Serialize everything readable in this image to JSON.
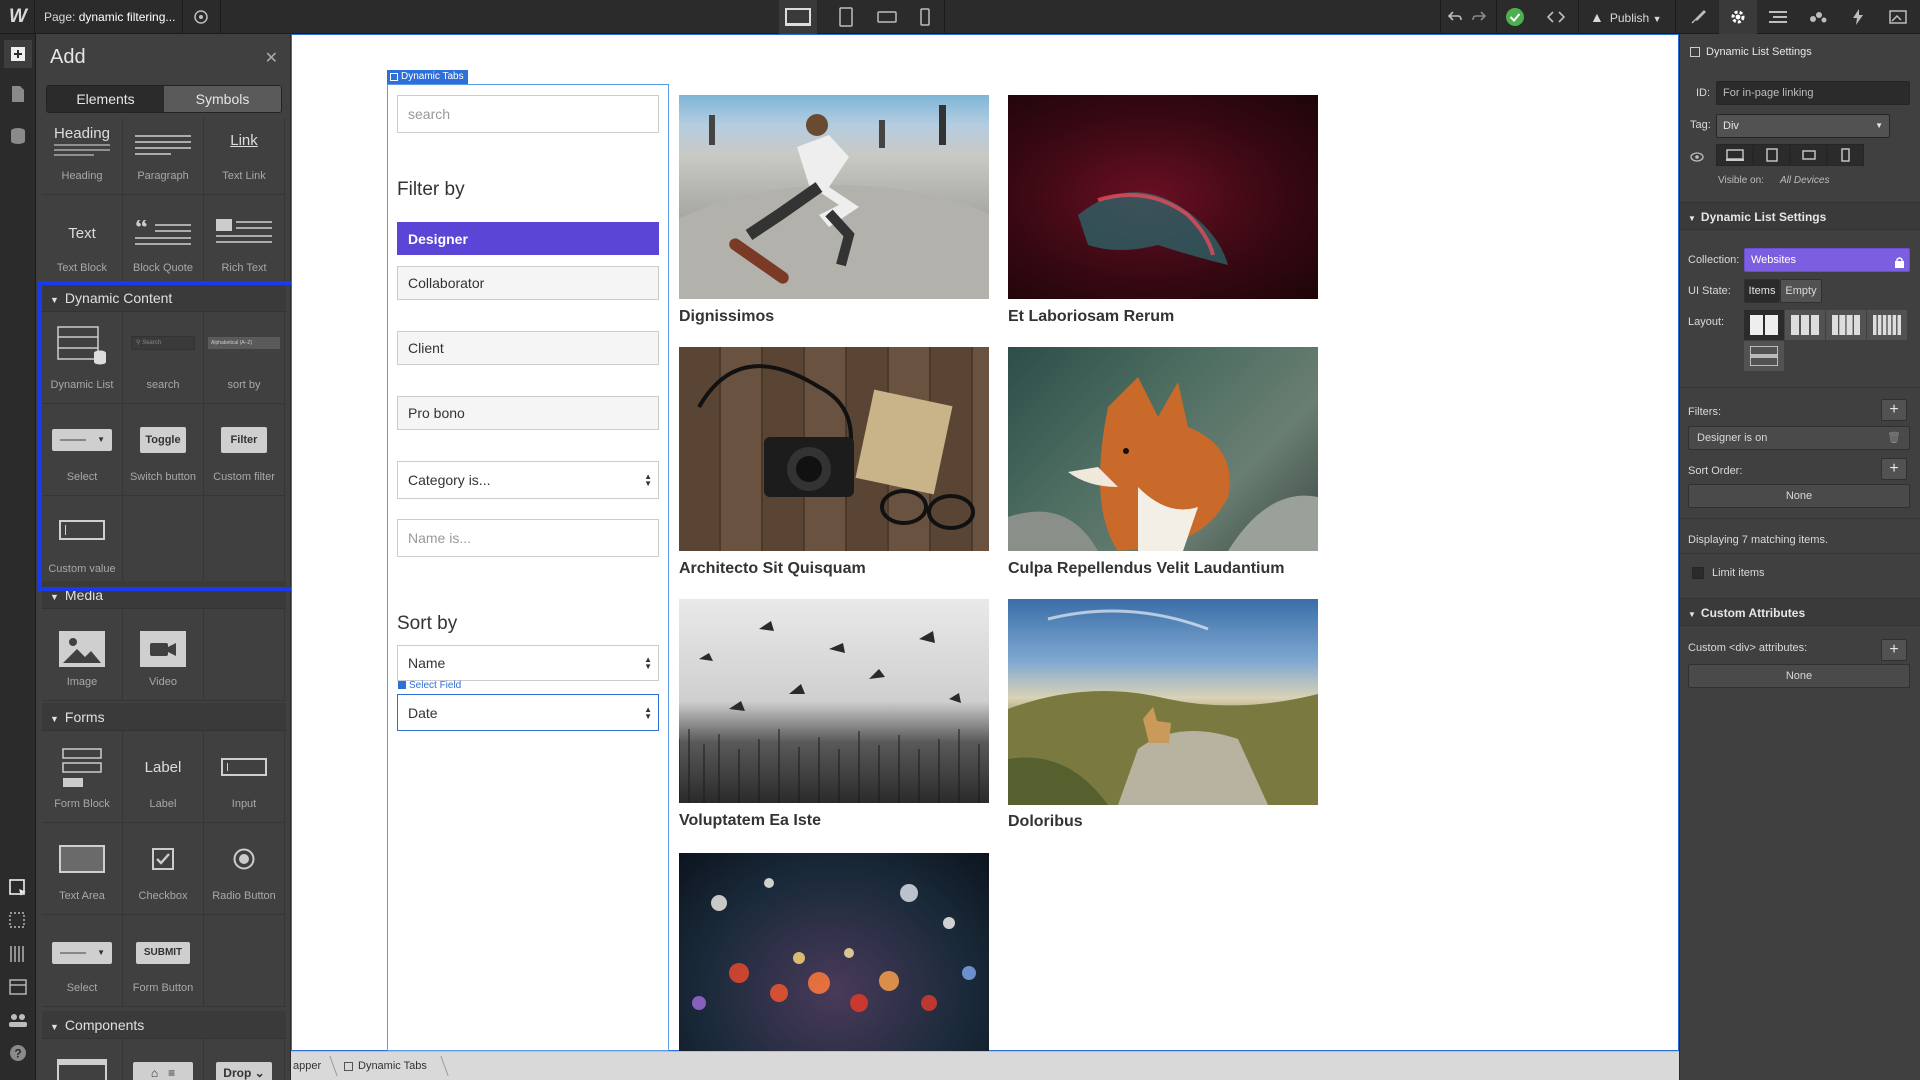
{
  "topbar": {
    "logo": "W",
    "page_prefix": "Page:",
    "page_name": "dynamic filtering...",
    "publish_label": "Publish",
    "undo_icon": "undo-icon",
    "redo_icon": "redo-icon",
    "devices": [
      "desktop",
      "tablet",
      "mobile-landscape",
      "mobile-portrait"
    ]
  },
  "add_panel": {
    "title": "Add",
    "tabs": [
      "Elements",
      "Symbols"
    ],
    "typography": [
      {
        "label": "Heading",
        "pic": "Heading"
      },
      {
        "label": "Paragraph",
        "pic": ""
      },
      {
        "label": "Text Link",
        "pic": "Link"
      },
      {
        "label": "Text Block",
        "pic": "Text"
      },
      {
        "label": "Block Quote",
        "pic": ""
      },
      {
        "label": "Rich Text",
        "pic": ""
      }
    ],
    "dynamic_content": {
      "title": "Dynamic Content",
      "items": [
        {
          "label": "Dynamic List"
        },
        {
          "label": "search",
          "pic": "Search"
        },
        {
          "label": "sort by",
          "pic": "Alphabetical (A–Z)"
        },
        {
          "label": "Select"
        },
        {
          "label": "Switch button",
          "pic": "Toggle"
        },
        {
          "label": "Custom filter",
          "pic": "Filter"
        },
        {
          "label": "Custom value"
        }
      ]
    },
    "media": {
      "title": "Media",
      "items": [
        {
          "label": "Image"
        },
        {
          "label": "Video"
        }
      ]
    },
    "forms": {
      "title": "Forms",
      "items": [
        {
          "label": "Form Block"
        },
        {
          "label": "Label",
          "pic": "Label"
        },
        {
          "label": "Input"
        },
        {
          "label": "Text Area"
        },
        {
          "label": "Checkbox"
        },
        {
          "label": "Radio Button"
        },
        {
          "label": "Select"
        },
        {
          "label": "Form Button",
          "pic": "SUBMIT"
        }
      ]
    },
    "components": {
      "title": "Components",
      "drop_pic": "Drop"
    }
  },
  "canvas": {
    "tag_label": "Dynamic Tabs",
    "search_placeholder": "search",
    "filter_heading": "Filter by",
    "filters": [
      "Designer",
      "Collaborator",
      "Client",
      "Pro bono"
    ],
    "category_select": "Category is...",
    "name_placeholder": "Name is...",
    "sort_heading": "Sort by",
    "sort_name": "Name",
    "select_field_tag": "Select Field",
    "sort_date": "Date",
    "cards": [
      "Dignissimos",
      "Et Laboriosam Rerum",
      "Architecto Sit Quisquam",
      "Culpa Repellendus Velit Laudantium",
      "Voluptatem Ea Iste",
      "Doloribus"
    ]
  },
  "breadcrumbs": [
    "apper",
    "Dynamic Tabs"
  ],
  "settings": {
    "header": "Dynamic List Settings",
    "id_label": "ID:",
    "id_placeholder": "For in-page linking",
    "tag_label": "Tag:",
    "tag_value": "Div",
    "visible_label": "Visible on:",
    "visible_value": "All Devices",
    "section": "Dynamic List Settings",
    "collection_label": "Collection:",
    "collection_value": "Websites",
    "ui_state_label": "UI State:",
    "ui_items": "Items",
    "ui_empty": "Empty",
    "layout_label": "Layout:",
    "filters_label": "Filters:",
    "filter_item": "Designer is on",
    "sort_label": "Sort Order:",
    "sort_value": "None",
    "displaying": "Displaying 7 matching items.",
    "limit_items": "Limit items",
    "custom_attr_section": "Custom Attributes",
    "custom_attr_label": "Custom <div> attributes:",
    "custom_attr_value": "None"
  },
  "colors": {
    "accent": "#5b45d6",
    "canvas_border": "#2f6fd9",
    "highlight": "#1a3af0",
    "publish_ok": "#4caf50"
  }
}
